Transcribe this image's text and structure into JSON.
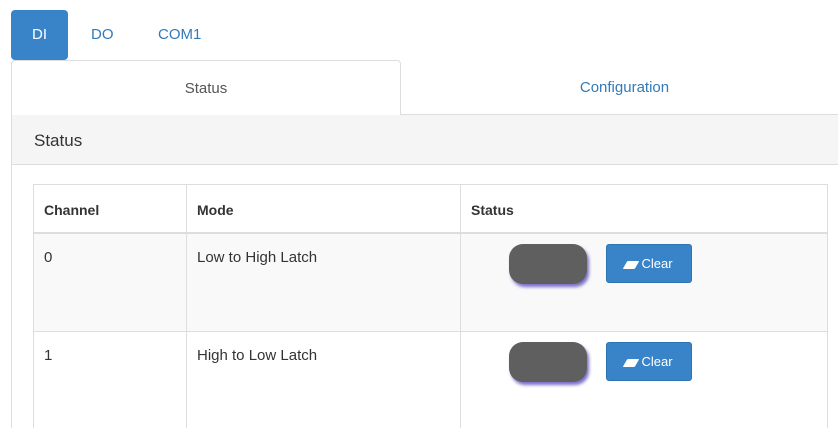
{
  "pills": [
    {
      "label": "DI",
      "active": true
    },
    {
      "label": "DO",
      "active": false
    },
    {
      "label": "COM1",
      "active": false
    }
  ],
  "tabs": [
    {
      "label": "Status",
      "active": true
    },
    {
      "label": "Configuration",
      "active": false
    }
  ],
  "panel": {
    "title": "Status"
  },
  "table": {
    "headers": [
      "Channel",
      "Mode",
      "Status"
    ],
    "rows": [
      {
        "channel": "0",
        "mode": "Low to High Latch",
        "clear_label": "Clear"
      },
      {
        "channel": "1",
        "mode": "High to Low Latch",
        "clear_label": "Clear"
      }
    ]
  },
  "icons": {
    "clear": "eraser-icon"
  },
  "colors": {
    "accent": "#3983c8",
    "link": "#337ab7",
    "toggle_off": "#5f5f5f"
  }
}
